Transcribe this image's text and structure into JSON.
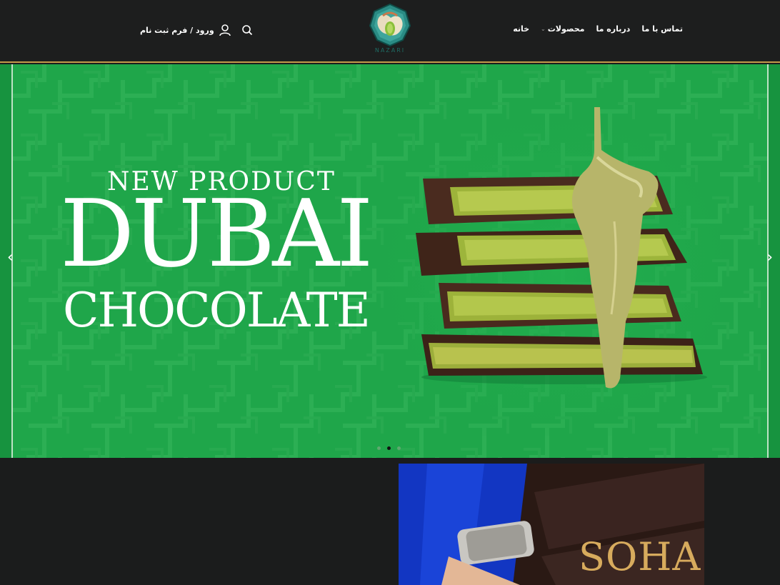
{
  "nav": {
    "items": [
      {
        "label": "خانه",
        "has_dropdown": false
      },
      {
        "label": "محصولات",
        "has_dropdown": true
      },
      {
        "label": "درباره ما",
        "has_dropdown": false
      },
      {
        "label": "تماس با ما",
        "has_dropdown": false
      }
    ]
  },
  "logo": {
    "text": "NAZARI"
  },
  "account": {
    "login_label": "ورود / فرم ثبت نام",
    "icons": [
      "user-icon",
      "search-icon"
    ]
  },
  "hero": {
    "kicker": "NEW PRODUCT",
    "title": "DUBAI",
    "subtitle": "CHOCOLATE",
    "prev_arrow": "‹",
    "next_arrow": "›",
    "slides": 3,
    "active_slide": 2
  },
  "promo": {
    "text": "SOHA"
  },
  "colors": {
    "header_bg": "#1d1e1e",
    "hero_green": "#1fa64a",
    "accent_gold": "#c49a4a",
    "page_bg": "#1b1c1c"
  }
}
